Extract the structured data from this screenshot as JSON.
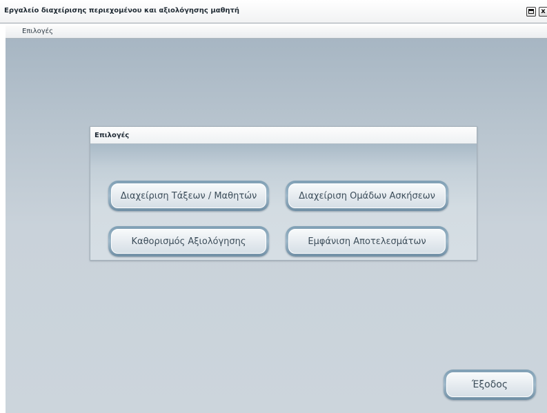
{
  "window": {
    "title": "Εργαλείο διαχείρισης περιεχομένου και αξιολόγησης μαθητή",
    "close_glyph": "x"
  },
  "menubar": {
    "items": [
      {
        "label": "Επιλογές"
      }
    ]
  },
  "panel": {
    "title": "Επιλογές",
    "buttons": [
      {
        "label": "Διαχείριση Τάξεων / Μαθητών"
      },
      {
        "label": "Διαχείριση Ομάδων Ασκήσεων"
      },
      {
        "label": "Καθορισμός Αξιολόγησης"
      },
      {
        "label": "Εμφάνιση Αποτελεσμάτων"
      }
    ]
  },
  "footer": {
    "exit_label": "Έξοδος"
  },
  "colors": {
    "background_top": "#a7b6c3",
    "background_bottom": "#ccd5dc",
    "button_border": "#7f9fb4",
    "button_text": "#3b4c59"
  }
}
